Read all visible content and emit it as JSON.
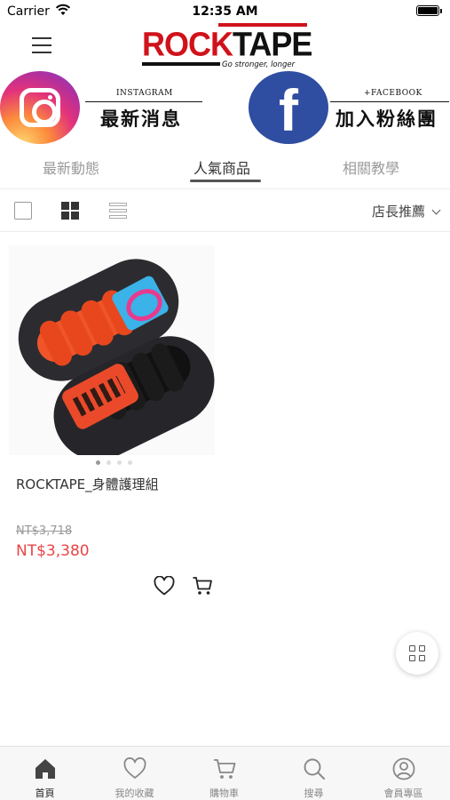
{
  "status_bar": {
    "carrier": "Carrier",
    "time": "12:35 AM"
  },
  "header": {
    "logo_text_red": "ROCK",
    "logo_text_dark": "TAPE",
    "logo_tagline": "Go stronger, longer"
  },
  "social": {
    "instagram": {
      "small_label": "INSTAGRAM",
      "big_label": "最新消息"
    },
    "facebook": {
      "small_label": "+FACEBOOK",
      "big_label": "加入粉絲團"
    }
  },
  "tabs": [
    {
      "label": "最新動態"
    },
    {
      "label": "人氣商品",
      "active": true
    },
    {
      "label": "相關教學"
    }
  ],
  "toolbar": {
    "sort_label": "店長推薦"
  },
  "products": [
    {
      "name": "ROCKTAPE_身體護理組",
      "original_price": "NT$3,718",
      "price": "NT$3,380",
      "image_dots": 4,
      "active_dot": 0
    }
  ],
  "bottom_nav": [
    {
      "label": "首頁",
      "icon": "home-icon",
      "active": true
    },
    {
      "label": "我的收藏",
      "icon": "heart-icon"
    },
    {
      "label": "購物車",
      "icon": "cart-icon"
    },
    {
      "label": "搜尋",
      "icon": "search-icon"
    },
    {
      "label": "會員專區",
      "icon": "user-icon"
    }
  ],
  "colors": {
    "brand_red": "#d0121b",
    "sale_price": "#e94545",
    "facebook_blue": "#2f4ea1"
  }
}
